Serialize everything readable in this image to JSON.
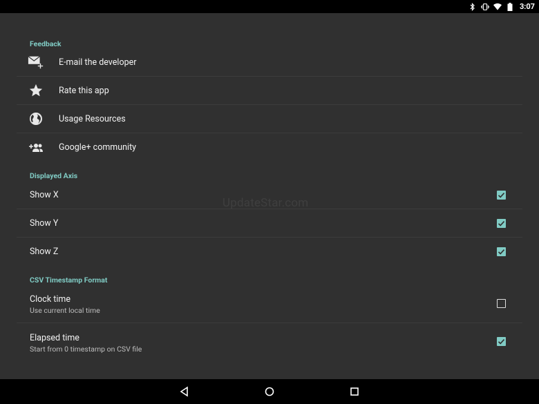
{
  "status_bar": {
    "time": "3:07",
    "icons": [
      "bluetooth-icon",
      "vibrate-icon",
      "wifi-icon",
      "battery-icon"
    ]
  },
  "watermark": "UpdateStar.com",
  "sections": {
    "feedback": {
      "header": "Feedback",
      "items": [
        {
          "label": "E-mail the developer",
          "icon": "email-add-icon"
        },
        {
          "label": "Rate this app",
          "icon": "star-icon"
        },
        {
          "label": "Usage Resources",
          "icon": "globe-icon"
        },
        {
          "label": "Google+ community",
          "icon": "group-add-icon"
        }
      ]
    },
    "displayed_axis": {
      "header": "Displayed Axis",
      "items": [
        {
          "label": "Show X",
          "checked": true
        },
        {
          "label": "Show Y",
          "checked": true
        },
        {
          "label": "Show Z",
          "checked": true
        }
      ]
    },
    "csv_timestamp": {
      "header": "CSV Timestamp Format",
      "items": [
        {
          "label": "Clock time",
          "summary": "Use current local time",
          "checked": false
        },
        {
          "label": "Elapsed time",
          "summary": "Start from 0 timestamp on CSV file",
          "checked": true
        }
      ]
    }
  },
  "colors": {
    "accent": "#80cbc4",
    "background": "#303030"
  }
}
